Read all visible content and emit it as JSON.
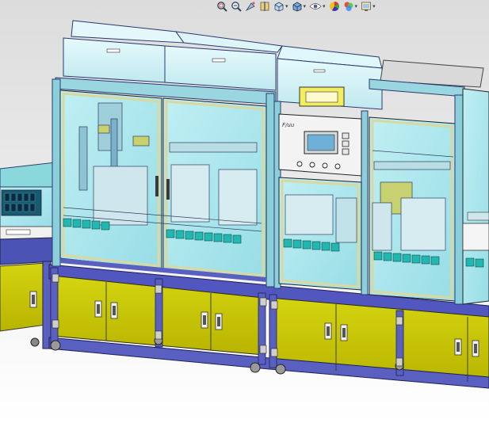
{
  "viewport": {
    "toolbar": [
      {
        "name": "zoom-to-fit-icon",
        "dropdown": false
      },
      {
        "name": "zoom-to-area-icon",
        "dropdown": false
      },
      {
        "name": "previous-view-icon",
        "dropdown": false
      },
      {
        "name": "section-view-icon",
        "dropdown": false
      },
      {
        "name": "view-orientation-icon",
        "dropdown": true
      },
      {
        "name": "display-style-icon",
        "dropdown": true
      },
      {
        "name": "hide-show-items-icon",
        "dropdown": true
      },
      {
        "name": "edit-appearance-icon",
        "dropdown": false
      },
      {
        "name": "apply-scene-icon",
        "dropdown": true
      },
      {
        "name": "view-settings-icon",
        "dropdown": true
      }
    ]
  },
  "model": {
    "hmi_logo": "F/uu",
    "colors": {
      "cabinet": "#c8c800",
      "frame": "#5a60c0",
      "glass": "#a8e8ee",
      "hood": "#cff2f6",
      "door_trim": "#d8d8a0",
      "display": "#f2ee60",
      "tray": "#20b8b0"
    }
  }
}
